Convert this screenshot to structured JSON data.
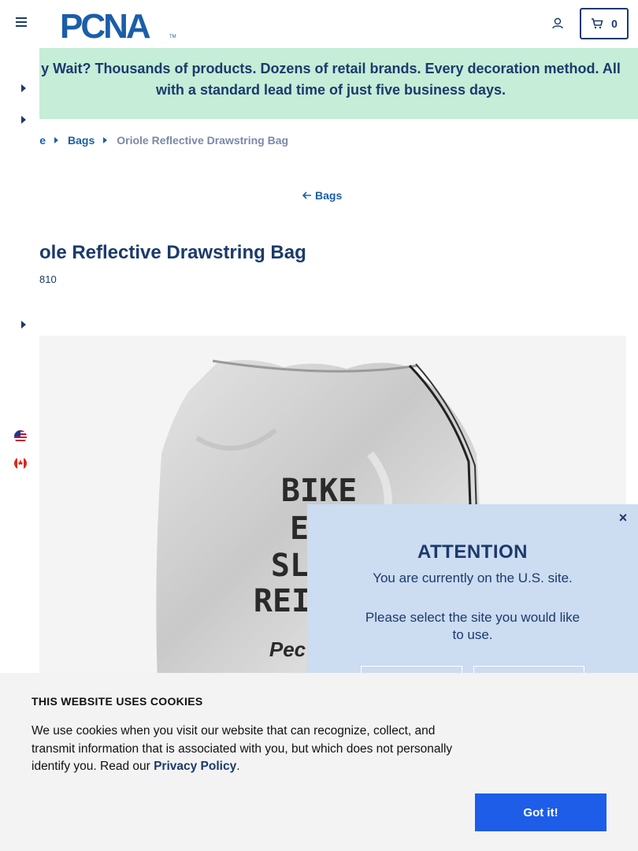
{
  "header": {
    "logo_text": "PCNA",
    "logo_tm": "TM",
    "cart_count": "0"
  },
  "banner": {
    "text_line1": "y Wait? Thousands of products. Dozens of retail brands. Every decoration method. All",
    "text_line2": "with a standard lead time of just five business days."
  },
  "breadcrumb": {
    "home": "e",
    "category": "Bags",
    "current": "Oriole Reflective Drawstring Bag"
  },
  "back_link": "Bags",
  "product": {
    "title": "ole Reflective Drawstring Bag",
    "sku": "810",
    "image_text": [
      "BIKE",
      "E",
      "SL",
      "REI",
      "Pec"
    ]
  },
  "attention": {
    "close": "×",
    "heading": "ATTENTION",
    "line1": "You are currently on the U.S. site.",
    "line2": "Please select the site you would like to use."
  },
  "cookie": {
    "title": "THIS WEBSITE USES COOKIES",
    "text_before": "We use cookies when you visit our website that can recognize, collect, and transmit information that is associated with you, but which does not personally identify you. Read our ",
    "link": "Privacy Policy",
    "text_after": ".",
    "button": "Got it!"
  },
  "colors": {
    "navy": "#1b3a6b",
    "link_blue": "#1b5ea8",
    "banner_green": "#c5edd8",
    "attention_bg": "#ccdcf1",
    "cookie_button": "#1d5de8"
  },
  "icons": [
    "hamburger-icon",
    "account-icon",
    "cart-icon",
    "chevron-right-icon",
    "us-flag-icon",
    "canada-flag-icon",
    "back-arrow-icon",
    "close-icon"
  ]
}
